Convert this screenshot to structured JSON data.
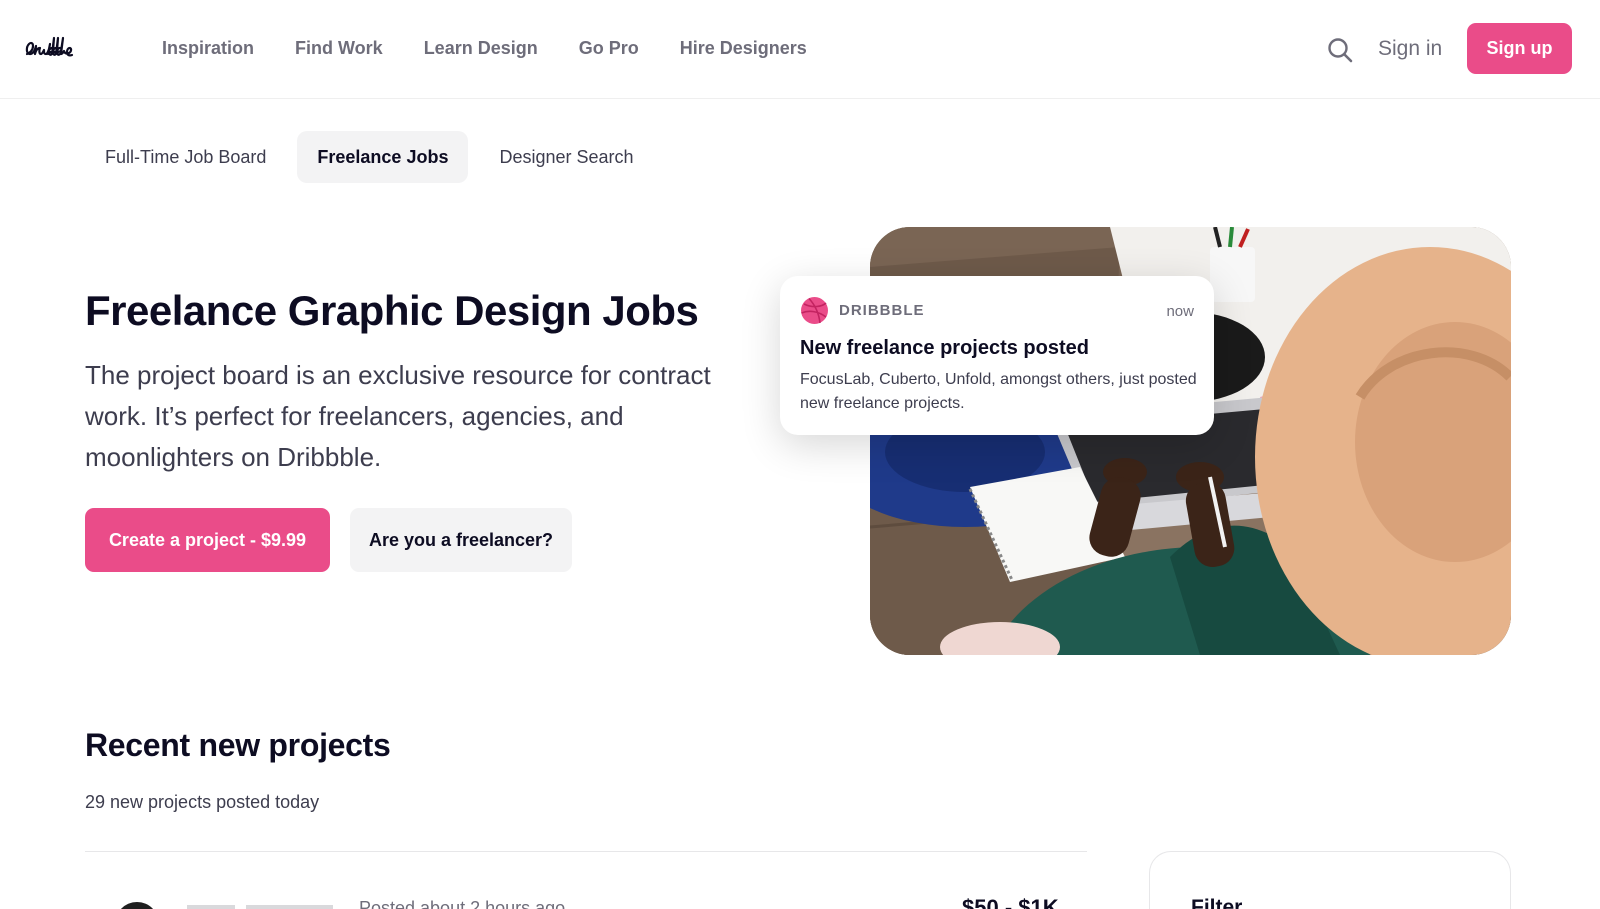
{
  "header": {
    "logo_text": "dribbble",
    "nav": [
      {
        "label": "Inspiration"
      },
      {
        "label": "Find Work"
      },
      {
        "label": "Learn Design"
      },
      {
        "label": "Go Pro"
      },
      {
        "label": "Hire Designers"
      }
    ],
    "search_icon": "search-icon",
    "signin_label": "Sign in",
    "signup_label": "Sign up"
  },
  "subtabs": [
    {
      "label": "Full-Time Job Board",
      "active": false
    },
    {
      "label": "Freelance Jobs",
      "active": true
    },
    {
      "label": "Designer Search",
      "active": false
    }
  ],
  "hero": {
    "title": "Freelance Graphic Design Jobs",
    "description": "The project board is an exclusive resource for contract work. It’s perfect for freelancers, agencies, and moonlighters on Dribbble.",
    "primary_cta": "Create a project - $9.99",
    "secondary_cta": "Are you a freelancer?"
  },
  "notification": {
    "brand": "DRIBBBLE",
    "time": "now",
    "title": "New freelance projects posted",
    "body": "FocusLab, Cuberto, Unfold, amongst others, just posted new freelance projects."
  },
  "recent": {
    "title": "Recent new projects",
    "count_text": "29 new projects posted today",
    "first_project": {
      "posted": "Posted about 2 hours ago",
      "price": "$50 - $1K"
    }
  },
  "filter": {
    "title": "Filter"
  },
  "colors": {
    "brand_pink": "#ea4c89",
    "text_dark": "#0d0c22",
    "text_muted": "#6e6d7a",
    "button_gray": "#f3f3f4"
  }
}
